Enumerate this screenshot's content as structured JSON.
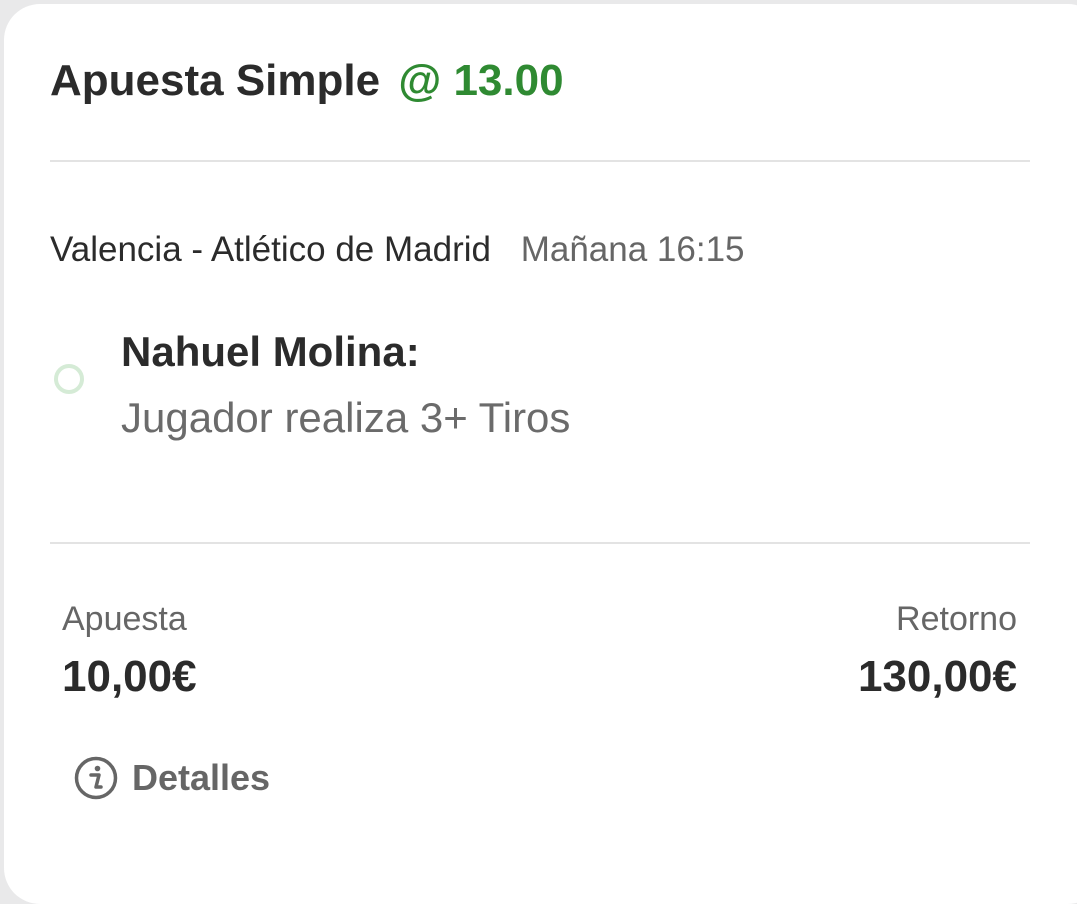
{
  "header": {
    "title": "Apuesta Simple",
    "odds": "@ 13.00",
    "odds_color": "#2f8a32"
  },
  "event": {
    "match": "Valencia - Atlético de Madrid",
    "time": "Mañana 16:15"
  },
  "selection": {
    "status_icon": "open-circle-icon",
    "player": "Nahuel Molina:",
    "market": "Jugador realiza 3+ Tiros"
  },
  "stake": {
    "label": "Apuesta",
    "value": "10,00€"
  },
  "return": {
    "label": "Retorno",
    "value": "130,00€"
  },
  "details": {
    "icon": "info-icon",
    "label": "Detalles"
  }
}
